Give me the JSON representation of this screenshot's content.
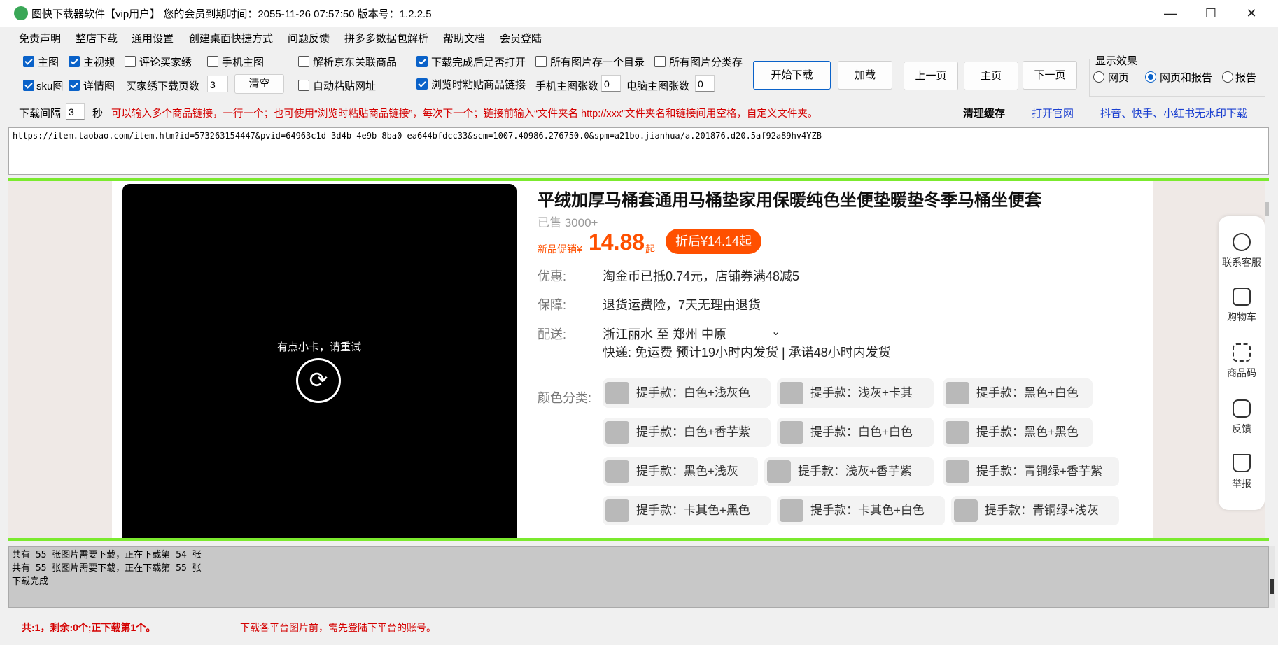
{
  "titlebar": {
    "title": "图快下载器软件【vip用户】 您的会员到期时间：2055-11-26 07:57:50  版本号：1.2.2.5",
    "minimize": "—",
    "maximize": "☐",
    "close": "✕"
  },
  "menu": [
    "免责声明",
    "整店下载",
    "通用设置",
    "创建桌面快捷方式",
    "问题反馈",
    "拼多多数据包解析",
    "帮助文档",
    "会员登陆"
  ],
  "options": {
    "main_image": "主图",
    "main_video": "主视频",
    "review_buyer_show": "评论买家绣",
    "mobile_main_image": "手机主图",
    "parse_jd_related": "解析京东关联商品",
    "open_after_download": "下载完成后是否打开",
    "all_in_one_dir": "所有图片存一个目录",
    "all_categorized": "所有图片分类存",
    "sku_image": "sku图",
    "detail_image": "详情图",
    "buyer_show_pages_label": "买家绣下载页数",
    "buyer_show_pages_value": "3",
    "clear_button": "清空",
    "auto_paste_url": "自动粘贴网址",
    "paste_link_on_browse": "浏览时粘贴商品链接",
    "mobile_main_count_label": "手机主图张数",
    "mobile_main_count_value": "0",
    "pc_main_count_label": "电脑主图张数",
    "pc_main_count_value": "0"
  },
  "buttons": {
    "start_download": "开始下载",
    "load": "加载",
    "prev_page": "上一页",
    "home_page": "主页",
    "next_page": "下一页"
  },
  "display_effect": {
    "title": "显示效果",
    "options": [
      "网页",
      "网页和报告",
      "报告"
    ],
    "selected": "网页和报告"
  },
  "interval": {
    "label": "下载间隔",
    "value": "3",
    "unit": "秒",
    "hint": "可以输入多个商品链接，一行一个；也可使用“浏览时粘贴商品链接”，每次下一个；链接前输入“文件夹名 http://xxx”文件夹名和链接间用空格，自定义文件夹。"
  },
  "links": {
    "clear_cache": "清理缓存",
    "open_site": "打开官网",
    "watermark_download": "抖音、快手、小红书无水印下载"
  },
  "url_input": "https://item.taobao.com/item.htm?id=573263154447&pvid=64963c1d-3d4b-4e9b-8ba0-ea644bfdcc33&scm=1007.40986.276750.0&spm=a21bo.jianhua/a.201876.d20.5af92a89hv4YZB",
  "product": {
    "video_error": "有点小卡，请重试",
    "title": "平绒加厚马桶套通用马桶垫家用保暖纯色坐便垫暖垫冬季马桶坐便套",
    "sold": "已售 3000+",
    "price_label": "新品促销¥",
    "price": "14.88",
    "price_suffix": "起",
    "discount": "折后¥14.14起",
    "benefit_label": "优惠:",
    "benefit_value": "淘金币已抵0.74元，店铺券满48减5",
    "guarantee_label": "保障:",
    "guarantee_value": "退货运费险，7天无理由退货",
    "delivery_label": "配送:",
    "delivery_value": "浙江丽水  至  郑州    中原",
    "delivery_detail": "快递: 免运费  预计19小时内发货 | 承诺48小时内发货",
    "color_label": "颜色分类:",
    "colors": [
      "提手款：白色+浅灰色",
      "提手款：浅灰+卡其",
      "提手款：黑色+白色",
      "提手款：白色+香芋紫",
      "提手款：白色+白色",
      "提手款：黑色+黑色",
      "提手款：黑色+浅灰",
      "提手款：浅灰+香芋紫",
      "提手款：青铜绿+香芋紫",
      "提手款：卡其色+黑色",
      "提手款：卡其色+白色",
      "提手款：青铜绿+浅灰"
    ]
  },
  "side_panel": [
    "联系客服",
    "购物车",
    "商品码",
    "反馈",
    "举报"
  ],
  "log": [
    "共有 55 张图片需要下载，正在下载第 54 张",
    "共有 55 张图片需要下载，正在下载第 55 张",
    "下载完成"
  ],
  "status": {
    "left": "共:1，剩余:0个;正下载第1个。",
    "right": "下载各平台图片前，需先登陆下平台的账号。"
  }
}
